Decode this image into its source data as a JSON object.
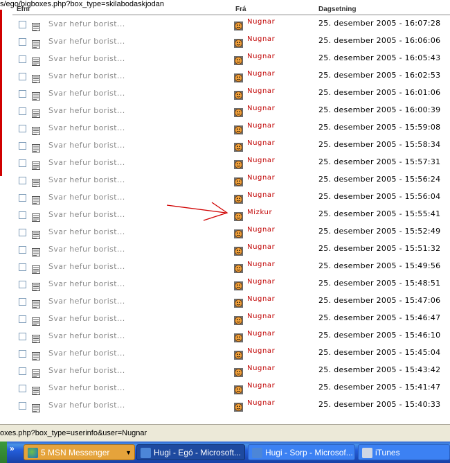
{
  "browser": {
    "url": "s/ego/bigboxes.php?box_type=skilabodaskjodan",
    "status_url": "oxes.php?box_type=userinfo&user=Nugnar"
  },
  "table": {
    "headers": [
      "Efni",
      "Frá",
      "Dagsetning"
    ],
    "rows": [
      {
        "subject": "Svar hefur borist...",
        "from": "Nugnar",
        "date": "25. desember 2005 - 16:07:28"
      },
      {
        "subject": "Svar hefur borist...",
        "from": "Nugnar",
        "date": "25. desember 2005 - 16:06:06"
      },
      {
        "subject": "Svar hefur borist...",
        "from": "Nugnar",
        "date": "25. desember 2005 - 16:05:43"
      },
      {
        "subject": "Svar hefur borist...",
        "from": "Nugnar",
        "date": "25. desember 2005 - 16:02:53"
      },
      {
        "subject": "Svar hefur borist...",
        "from": "Nugnar",
        "date": "25. desember 2005 - 16:01:06"
      },
      {
        "subject": "Svar hefur borist...",
        "from": "Nugnar",
        "date": "25. desember 2005 - 16:00:39"
      },
      {
        "subject": "Svar hefur borist...",
        "from": "Nugnar",
        "date": "25. desember 2005 - 15:59:08"
      },
      {
        "subject": "Svar hefur borist...",
        "from": "Nugnar",
        "date": "25. desember 2005 - 15:58:34"
      },
      {
        "subject": "Svar hefur borist...",
        "from": "Nugnar",
        "date": "25. desember 2005 - 15:57:31"
      },
      {
        "subject": "Svar hefur borist...",
        "from": "Nugnar",
        "date": "25. desember 2005 - 15:56:24"
      },
      {
        "subject": "Svar hefur borist...",
        "from": "Nugnar",
        "date": "25. desember 2005 - 15:56:04"
      },
      {
        "subject": "Svar hefur borist...",
        "from": "Mizkur",
        "date": "25. desember 2005 - 15:55:41"
      },
      {
        "subject": "Svar hefur borist...",
        "from": "Nugnar",
        "date": "25. desember 2005 - 15:52:49"
      },
      {
        "subject": "Svar hefur borist...",
        "from": "Nugnar",
        "date": "25. desember 2005 - 15:51:32"
      },
      {
        "subject": "Svar hefur borist...",
        "from": "Nugnar",
        "date": "25. desember 2005 - 15:49:56"
      },
      {
        "subject": "Svar hefur borist...",
        "from": "Nugnar",
        "date": "25. desember 2005 - 15:48:51"
      },
      {
        "subject": "Svar hefur borist...",
        "from": "Nugnar",
        "date": "25. desember 2005 - 15:47:06"
      },
      {
        "subject": "Svar hefur borist...",
        "from": "Nugnar",
        "date": "25. desember 2005 - 15:46:47"
      },
      {
        "subject": "Svar hefur borist...",
        "from": "Nugnar",
        "date": "25. desember 2005 - 15:46:10"
      },
      {
        "subject": "Svar hefur borist...",
        "from": "Nugnar",
        "date": "25. desember 2005 - 15:45:04"
      },
      {
        "subject": "Svar hefur borist...",
        "from": "Nugnar",
        "date": "25. desember 2005 - 15:43:42"
      },
      {
        "subject": "Svar hefur borist...",
        "from": "Nugnar",
        "date": "25. desember 2005 - 15:41:47"
      },
      {
        "subject": "Svar hefur borist...",
        "from": "Nugnar",
        "date": "25. desember 2005 - 15:40:33"
      }
    ]
  },
  "taskbar": {
    "buttons": [
      {
        "label": "5 MSN Messenger",
        "icon": "msn-icon"
      },
      {
        "label": "Hugi - Egó - Microsoft...",
        "icon": "ie-icon"
      },
      {
        "label": "Hugi - Sorp - Microsof...",
        "icon": "ie-icon"
      },
      {
        "label": "iTunes",
        "icon": "itunes-icon"
      }
    ]
  },
  "colors": {
    "sender": "#c00000",
    "subject": "#8a8a8a",
    "annotation_arrow": "#d00000",
    "taskbar": "#245edb"
  }
}
